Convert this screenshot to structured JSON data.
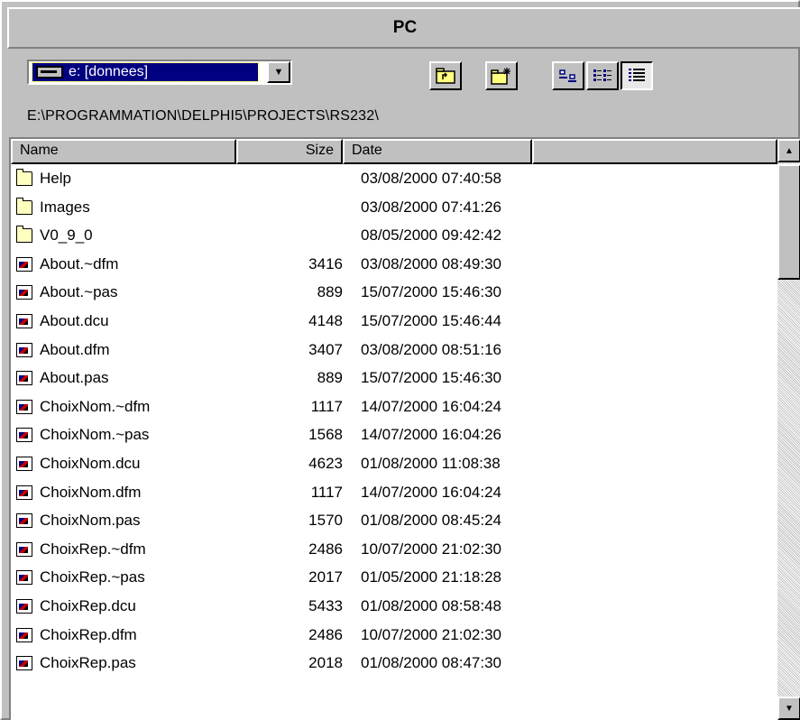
{
  "window": {
    "title": "PC"
  },
  "toolbar": {
    "drive_selected": "e: [donnees]",
    "buttons": [
      "parent-folder",
      "new-folder",
      "large-icons",
      "list-view",
      "details-view"
    ]
  },
  "path": "E:\\PROGRAMMATION\\DELPHI5\\PROJECTS\\RS232\\",
  "columns": [
    "Name",
    "Size",
    "Date",
    ""
  ],
  "rows": [
    {
      "name": "Help",
      "size": "",
      "date": "03/08/2000 07:40:58",
      "type": "folder"
    },
    {
      "name": "Images",
      "size": "",
      "date": "03/08/2000 07:41:26",
      "type": "folder"
    },
    {
      "name": "V0_9_0",
      "size": "",
      "date": "08/05/2000 09:42:42",
      "type": "folder"
    },
    {
      "name": "About.~dfm",
      "size": "3416",
      "date": "03/08/2000 08:49:30",
      "type": "file"
    },
    {
      "name": "About.~pas",
      "size": "889",
      "date": "15/07/2000 15:46:30",
      "type": "file"
    },
    {
      "name": "About.dcu",
      "size": "4148",
      "date": "15/07/2000 15:46:44",
      "type": "file"
    },
    {
      "name": "About.dfm",
      "size": "3407",
      "date": "03/08/2000 08:51:16",
      "type": "file"
    },
    {
      "name": "About.pas",
      "size": "889",
      "date": "15/07/2000 15:46:30",
      "type": "file"
    },
    {
      "name": "ChoixNom.~dfm",
      "size": "1117",
      "date": "14/07/2000 16:04:24",
      "type": "file"
    },
    {
      "name": "ChoixNom.~pas",
      "size": "1568",
      "date": "14/07/2000 16:04:26",
      "type": "file"
    },
    {
      "name": "ChoixNom.dcu",
      "size": "4623",
      "date": "01/08/2000 11:08:38",
      "type": "file"
    },
    {
      "name": "ChoixNom.dfm",
      "size": "1117",
      "date": "14/07/2000 16:04:24",
      "type": "file"
    },
    {
      "name": "ChoixNom.pas",
      "size": "1570",
      "date": "01/08/2000 08:45:24",
      "type": "file"
    },
    {
      "name": "ChoixRep.~dfm",
      "size": "2486",
      "date": "10/07/2000 21:02:30",
      "type": "file"
    },
    {
      "name": "ChoixRep.~pas",
      "size": "2017",
      "date": "01/05/2000 21:18:28",
      "type": "file"
    },
    {
      "name": "ChoixRep.dcu",
      "size": "5433",
      "date": "01/08/2000 08:58:48",
      "type": "file"
    },
    {
      "name": "ChoixRep.dfm",
      "size": "2486",
      "date": "10/07/2000 21:02:30",
      "type": "file"
    },
    {
      "name": "ChoixRep.pas",
      "size": "2018",
      "date": "01/08/2000 08:47:30",
      "type": "file"
    }
  ]
}
